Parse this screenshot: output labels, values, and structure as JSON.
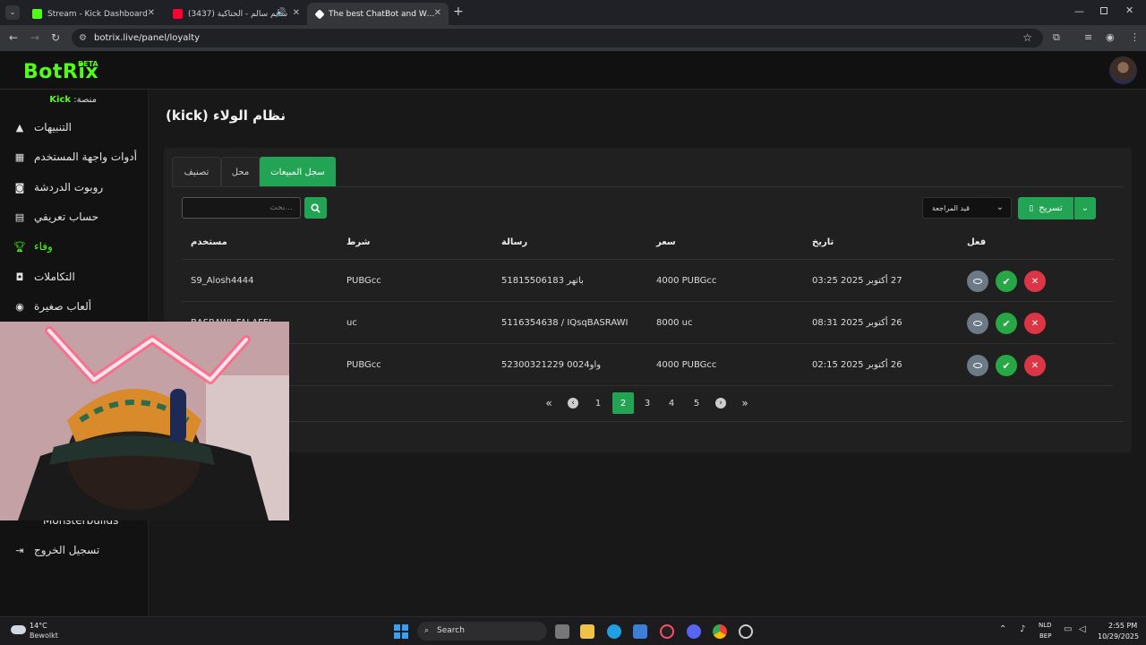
{
  "browser": {
    "tabs": [
      {
        "title": "Stream - Kick Dashboard",
        "favicon_color": "#53fc18"
      },
      {
        "title": "(3437) سليم سالم - الختاكية",
        "favicon_color": "#ff0033"
      },
      {
        "title": "The best ChatBot and Widgets",
        "favicon_color": "#ffffff"
      }
    ],
    "url": "botrix.live/panel/loyalty"
  },
  "app": {
    "logo": "BotRix",
    "beta": "BETA",
    "platform_prefix": "منصة:",
    "platform_name": "Kick",
    "accent_color": "#53fc18",
    "button_color": "#23a455"
  },
  "sidebar": {
    "items": [
      {
        "label": "التنبيهات",
        "icon": "warning-icon"
      },
      {
        "label": "أدوات واجهة المستخدم",
        "icon": "widgets-icon"
      },
      {
        "label": "روبوت الدردشة",
        "icon": "robot-icon"
      },
      {
        "label": "حساب تعريفي",
        "icon": "id-card-icon"
      },
      {
        "label": "وفاء",
        "icon": "trophy-icon",
        "active": true
      },
      {
        "label": "التكاملات",
        "icon": "integration-icon"
      },
      {
        "label": "ألعاب صغيرة",
        "icon": "gamepad-icon"
      },
      {
        "label": "Monsterbuilds",
        "icon": "build-icon"
      },
      {
        "label": "تسجيل الخروج",
        "icon": "logout-icon"
      }
    ]
  },
  "main": {
    "title": "نظام الولاء (kick)",
    "tabs": [
      "سجل المبيعات",
      "محل",
      "تصنيف"
    ],
    "search_placeholder": "...بحث",
    "sort_label": "قيد المراجعة",
    "export_label": "تسريح",
    "table": {
      "headers": [
        "مستخدم",
        "شرط",
        "رسالة",
        "سعر",
        "تاريخ",
        "فعل"
      ],
      "rows": [
        {
          "user": "S9_Alosh4444",
          "item": "PUBGcc",
          "message": "51815506183 باتهر",
          "price": "4000 PUBGcc",
          "date": "27 أكتوبر 2025 03:25"
        },
        {
          "user": "BASRAWI_FALAFEL",
          "item": "uc",
          "message": "5116354638 / IQsqBASRAWI",
          "price": "8000 uc",
          "date": "26 أكتوبر 2025 08:31"
        },
        {
          "user": "",
          "item": "PUBGcc",
          "message": "52300321229 0024واو",
          "price": "4000 PUBGcc",
          "date": "26 أكتوبر 2025 02:15"
        }
      ]
    },
    "pagination": {
      "pages": [
        "1",
        "2",
        "3",
        "4",
        "5"
      ],
      "current": "2"
    }
  },
  "taskbar": {
    "weather_temp": "14°C",
    "weather_desc": "Bewolkt",
    "search": "Search",
    "lang_line1": "NLD",
    "lang_line2": "BEP",
    "time": "2:55 PM",
    "date": "10/29/2025"
  }
}
